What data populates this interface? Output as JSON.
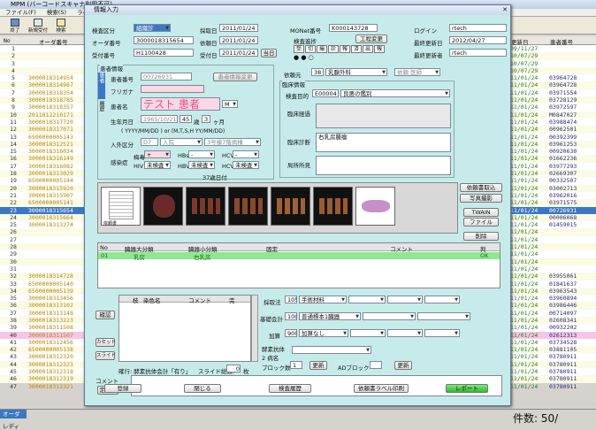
{
  "app": {
    "title": "MPM (バーコードスキャナ利用不可)"
  },
  "menu": [
    "ファイル(F)",
    "検索(S)",
    "ラベル(L)"
  ],
  "toolbar": {
    "exit": "終了",
    "new": "新規受付",
    "search": "検索"
  },
  "grid": {
    "headers": {
      "no": "No",
      "order": "オーダ番号",
      "updated": "更新日",
      "patient": "患者番号"
    },
    "rows": [
      {
        "no": "1",
        "order": "",
        "date": "09/11/27",
        "pat": ""
      },
      {
        "no": "2",
        "order": "",
        "date": "10/07/29",
        "pat": ""
      },
      {
        "no": "3",
        "order": "",
        "date": "10/07/29",
        "pat": ""
      },
      {
        "no": "4",
        "order": "",
        "date": "10/07/29",
        "pat": ""
      },
      {
        "no": "5",
        "order": "3000018314954",
        "date": "11/01/24",
        "pat": "03964728"
      },
      {
        "no": "6",
        "order": "3000018314967",
        "date": "11/01/24",
        "pat": "03964728"
      },
      {
        "no": "7",
        "order": "3000018318354",
        "date": "11/01/24",
        "pat": "03971554"
      },
      {
        "no": "8",
        "order": "3000018318785",
        "date": "11/01/24",
        "pat": "03728129"
      },
      {
        "no": "9",
        "order": "3000018318357",
        "date": "11/01/24",
        "pat": "03972597"
      },
      {
        "no": "10",
        "order": "2011012210171",
        "date": "11/01/24",
        "pat": "M0847027"
      },
      {
        "no": "11",
        "order": "3000018317720",
        "date": "11/01/24",
        "pat": "03988474"
      },
      {
        "no": "12",
        "order": "3000018317071",
        "date": "11/01/24",
        "pat": "00962501"
      },
      {
        "no": "13",
        "order": "6500000005143",
        "date": "11/01/24",
        "pat": "00392399"
      },
      {
        "no": "14",
        "order": "3000018312521",
        "date": "11/01/24",
        "pat": "03961253"
      },
      {
        "no": "15",
        "order": "3000018316034",
        "date": "11/01/24",
        "pat": "00920630"
      },
      {
        "no": "16",
        "order": "3000018316149",
        "date": "11/01/24",
        "pat": "01662236"
      },
      {
        "no": "17",
        "order": "3000018316082",
        "date": "11/01/24",
        "pat": "03977293"
      },
      {
        "no": "18",
        "order": "3000018313029",
        "date": "11/01/24",
        "pat": "02669307"
      },
      {
        "no": "19",
        "order": "6500000005144",
        "date": "11/01/24",
        "pat": "00332507"
      },
      {
        "no": "20",
        "order": "3000018315920",
        "date": "11/01/24",
        "pat": "03002713"
      },
      {
        "no": "21",
        "order": "3000018315907",
        "date": "11/01/24",
        "pat": "03962016"
      },
      {
        "no": "22",
        "order": "6500000005141",
        "date": "11/01/24",
        "pat": "03971575"
      },
      {
        "no": "23",
        "order": "3000018315654",
        "date": "11/01/24",
        "pat": "00726931"
      },
      {
        "no": "24",
        "order": "3000018315664",
        "date": "11/01/24",
        "pat": "00006068"
      },
      {
        "no": "25",
        "order": "3000018313274",
        "date": "11/01/24",
        "pat": "01459015"
      },
      {
        "no": "26",
        "order": "",
        "date": "11/01/24",
        "pat": ""
      },
      {
        "no": "27",
        "order": "",
        "date": "11/01/24",
        "pat": ""
      },
      {
        "no": "28",
        "order": "",
        "date": "11/01/24",
        "pat": ""
      },
      {
        "no": "29",
        "order": "",
        "date": "11/01/24",
        "pat": ""
      },
      {
        "no": "30",
        "order": "",
        "date": "11/01/24",
        "pat": ""
      },
      {
        "no": "31",
        "order": "",
        "date": "11/01/24",
        "pat": ""
      },
      {
        "no": "32",
        "order": "3000018314728",
        "date": "11/01/24",
        "pat": "03955061"
      },
      {
        "no": "33",
        "order": "6500000005140",
        "date": "11/01/24",
        "pat": "01841637"
      },
      {
        "no": "34",
        "order": "6500000005139",
        "date": "11/01/24",
        "pat": "03963543"
      },
      {
        "no": "35",
        "order": "3000018313456",
        "date": "11/01/24",
        "pat": "03960894"
      },
      {
        "no": "36",
        "order": "3000018313102",
        "date": "11/01/24",
        "pat": "03986446"
      },
      {
        "no": "37",
        "order": "3000018313148",
        "date": "11/01/24",
        "pat": "00714097"
      },
      {
        "no": "38",
        "order": "3000018313223",
        "date": "11/01/24",
        "pat": "02608341"
      },
      {
        "no": "39",
        "order": "3000018311508",
        "date": "11/01/24",
        "pat": "00932202"
      },
      {
        "no": "40",
        "order": "3000018311507",
        "date": "11/01/24",
        "pat": "02612313"
      },
      {
        "no": "41",
        "order": "3000018312456",
        "date": "11/01/24",
        "pat": "03734528"
      },
      {
        "no": "42",
        "order": "6500000005138",
        "date": "11/01/24",
        "pat": "03881105"
      },
      {
        "no": "43",
        "order": "3000018312320",
        "date": "11/01/24",
        "pat": "03780911"
      },
      {
        "no": "44",
        "order": "3000018312323",
        "date": "11/01/24",
        "pat": "03780911"
      },
      {
        "no": "45",
        "order": "3000018312318",
        "date": "11/01/24",
        "pat": "03780911"
      },
      {
        "no": "46",
        "order": "3000018312319",
        "date": "11/01/24",
        "pat": "03780911"
      },
      {
        "no": "47",
        "order": "3000018312321",
        "date": "11/01/24",
        "pat": "03780911"
      }
    ]
  },
  "status": {
    "left": "オーダ",
    "ready": "レディ",
    "count_label": "件数:",
    "count": "50/"
  },
  "dialog": {
    "title": "情報入力",
    "exam_type_label": "検査区分",
    "exam_type": "組織診",
    "order_no_label": "オーダ番号",
    "order_no": "3000018315654",
    "receipt_no_label": "受付番号",
    "receipt_no": "H1100428",
    "collect_date_label": "採取日",
    "collect_date": "2011/01/24",
    "request_date_label": "依頼日",
    "request_date": "2011/01/24",
    "receipt_date_label": "受付日",
    "receipt_date": "2011/01/24",
    "today_btn": "当日",
    "monet_label": "MONet番号",
    "monet": "K000143728",
    "exam_progress_label": "検査進捗",
    "process_change_btn": "工程変更",
    "process_steps": [
      "受",
      "切",
      "撮",
      "診",
      "報",
      "済",
      "出",
      "報"
    ],
    "login_label": "ログイン",
    "login": "rtech",
    "last_update_label": "最終更新日",
    "last_update": "2012/04/27",
    "last_updater_label": "最終更新者",
    "last_updater": "rtech",
    "patient": {
      "group": "患者情報",
      "side_a": "患者",
      "side_b": "履歴",
      "id_label": "患者番号",
      "id": "00726931",
      "change_btn": "患者情報変更",
      "kana_label": "フリガナ",
      "kana": "",
      "name_label": "患者名",
      "name": "テスト 患者",
      "sex": "M",
      "dob_label": "生年月日",
      "dob": "1965/10/21",
      "age": "45",
      "age_unit": "歳",
      "months": "3",
      "months_unit": "ヶ月",
      "dob_hint": "( YYYY/MM/DD ) or (M,T,S,H YY/MM/DD)",
      "admit_label": "入外区分",
      "ward": "D7",
      "admit": "入院",
      "room": "3号棟7階病棟",
      "infect_label": "感染症",
      "infect": [
        {
          "name": "梅毒",
          "val": "+"
        },
        {
          "name": "HBs",
          "val": "-"
        },
        {
          "name": "HCV",
          "val": "-"
        },
        {
          "name": "HIV",
          "val": "未検査"
        },
        {
          "name": "HBV",
          "val": "未検査"
        },
        {
          "name": "HCV",
          "val": "未検査"
        }
      ],
      "protein_note": "37歳日付"
    },
    "request": {
      "dept_label": "依頼元",
      "dept_code": "38",
      "dept": "乳腺外科",
      "doctor_label": "依頼",
      "doctor": "医師",
      "clinical_label": "臨床情報",
      "purpose_label": "検査目的",
      "purpose_code": "E00004",
      "purpose": "良悪の鑑別",
      "course_label": "臨床経過",
      "dx_label": "臨床診断",
      "dx": "右乳房腫瘤",
      "local_label": "局所所見"
    },
    "image_side": {
      "capture": "依頼書取込",
      "photo": "写真撮影",
      "twain": "TWAIN",
      "file": "ファイル",
      "delete": "削除",
      "thumb_caption": "依頼書"
    },
    "specimen": {
      "headers": [
        "No",
        "臓器大分類",
        "臓器小分類",
        "固定",
        "コメント",
        "判"
      ],
      "rows": [
        {
          "no": "01",
          "major": "乳房",
          "minor": "右乳房",
          "fix": "",
          "comment": "",
          "judge": "OK"
        }
      ]
    },
    "stain": {
      "confirm_btn": "確認",
      "cassette_btn": "カセット",
      "slide_btn": "スライド",
      "headers": [
        "",
        "枝",
        "染色名",
        "コメント",
        "完"
      ],
      "note": "確行: 酵素抗体会計「有り」",
      "slide_count_label": "スライド総数:",
      "slide_count": "0",
      "slide_unit": "枚"
    },
    "billing": {
      "collect_method_label": "採取法",
      "collect_method_code": "105",
      "collect_method": "手術材料",
      "basic_label": "基礎会計",
      "basic_code": "100",
      "basic": "普通標本1臓器",
      "add_label": "加算",
      "add_code": "900",
      "add": "加算なし",
      "enzyme_label": "酵素抗体2 病名",
      "block_label": "ブロック数",
      "block": "1",
      "update_btn": "更新",
      "ad_label": "ADブロック",
      "update_btn2": "更新"
    },
    "comment": {
      "label": "コメント",
      "template_btn": "定型文"
    },
    "footer": {
      "register": "登録",
      "close": "閉じる",
      "history": "検査履歴",
      "print": "依頼書ラベル印刷",
      "report": "レポート"
    }
  }
}
